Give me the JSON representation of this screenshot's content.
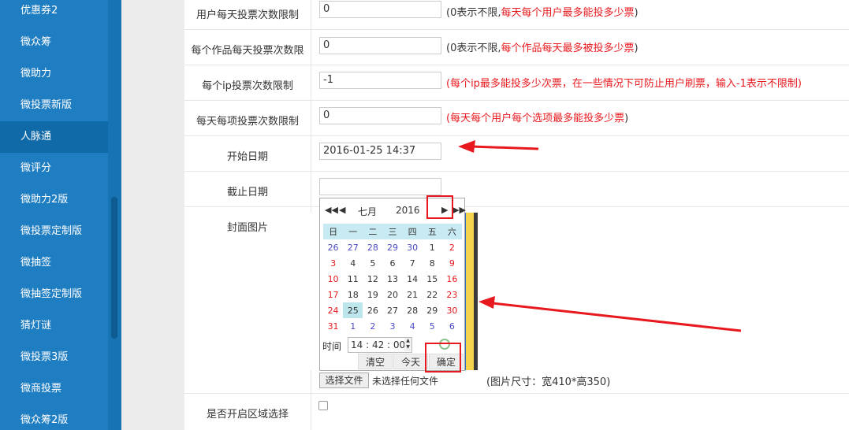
{
  "sidebar": {
    "items": [
      {
        "label": "优惠券2"
      },
      {
        "label": "微众筹"
      },
      {
        "label": "微助力"
      },
      {
        "label": "微投票新版"
      },
      {
        "label": "人脉通"
      },
      {
        "label": "微评分"
      },
      {
        "label": "微助力2版"
      },
      {
        "label": "微投票定制版"
      },
      {
        "label": "微抽签"
      },
      {
        "label": "微抽签定制版"
      },
      {
        "label": "猜灯谜"
      },
      {
        "label": "微投票3版"
      },
      {
        "label": "微商投票"
      },
      {
        "label": "微众筹2版"
      }
    ],
    "active_index": 4
  },
  "form": {
    "user_daily_limit": {
      "label": "用户每天投票次数限制",
      "value": "0",
      "hint_prefix": "(0表示不限,",
      "hint_red": "每天每个用户最多能投多少票",
      "hint_suffix": ")"
    },
    "work_daily_limit": {
      "label": "每个作品每天投票次数限",
      "value": "0",
      "hint_prefix": "(0表示不限,",
      "hint_red": "每个作品每天最多被投多少票",
      "hint_suffix": ")"
    },
    "ip_limit": {
      "label": "每个ip投票次数限制",
      "value": "-1",
      "hint_red": "(每个ip最多能投多少次票，在一些情况下可防止用户刷票，输入-1表示不限制)"
    },
    "item_daily_limit": {
      "label": "每天每项投票次数限制",
      "value": "0",
      "hint_red": "(每天每个用户每个选项最多能投多少票",
      "hint_suffix": ")"
    },
    "start_date": {
      "label": "开始日期",
      "value": "2016-01-25 14:37"
    },
    "end_date": {
      "label": "截止日期",
      "value": ""
    },
    "cover": {
      "label": "封面图片",
      "file_button": "选择文件",
      "file_status": "未选择任何文件",
      "size_hint": "(图片尺寸：宽410*高350)"
    },
    "region": {
      "label": "是否开启区域选择",
      "checked": false
    }
  },
  "calendar": {
    "nav": {
      "prev_year": "◀◀",
      "prev_month": "◀",
      "month": "七月",
      "year": "2016",
      "next_month": "▶",
      "next_year": "▶▶"
    },
    "weekdays": [
      "日",
      "一",
      "二",
      "三",
      "四",
      "五",
      "六"
    ],
    "weeks": [
      [
        "26",
        "27",
        "28",
        "29",
        "30",
        "1",
        "2"
      ],
      [
        "3",
        "4",
        "5",
        "6",
        "7",
        "8",
        "9"
      ],
      [
        "10",
        "11",
        "12",
        "13",
        "14",
        "15",
        "16"
      ],
      [
        "17",
        "18",
        "19",
        "20",
        "21",
        "22",
        "23"
      ],
      [
        "24",
        "25",
        "26",
        "27",
        "28",
        "29",
        "30"
      ],
      [
        "31",
        "1",
        "2",
        "3",
        "4",
        "5",
        "6"
      ]
    ],
    "selected_day": "25",
    "time_label": "时间",
    "time_value": "14 : 42 : 00",
    "spin_up": "▲",
    "spin_down": "▼",
    "buttons": {
      "clear": "清空",
      "today": "今天",
      "ok": "确定"
    }
  },
  "colors": {
    "sidebar_bg": "#1f7ec1",
    "sidebar_active": "#116aa8",
    "hint_red": "#e8191e",
    "annotation_red": "#e8191e",
    "weekday_header": "#c8eaf2"
  },
  "icons": {
    "clock": "clock-icon",
    "spin": "spinner-arrows-icon",
    "nav": "chevron-icons"
  }
}
